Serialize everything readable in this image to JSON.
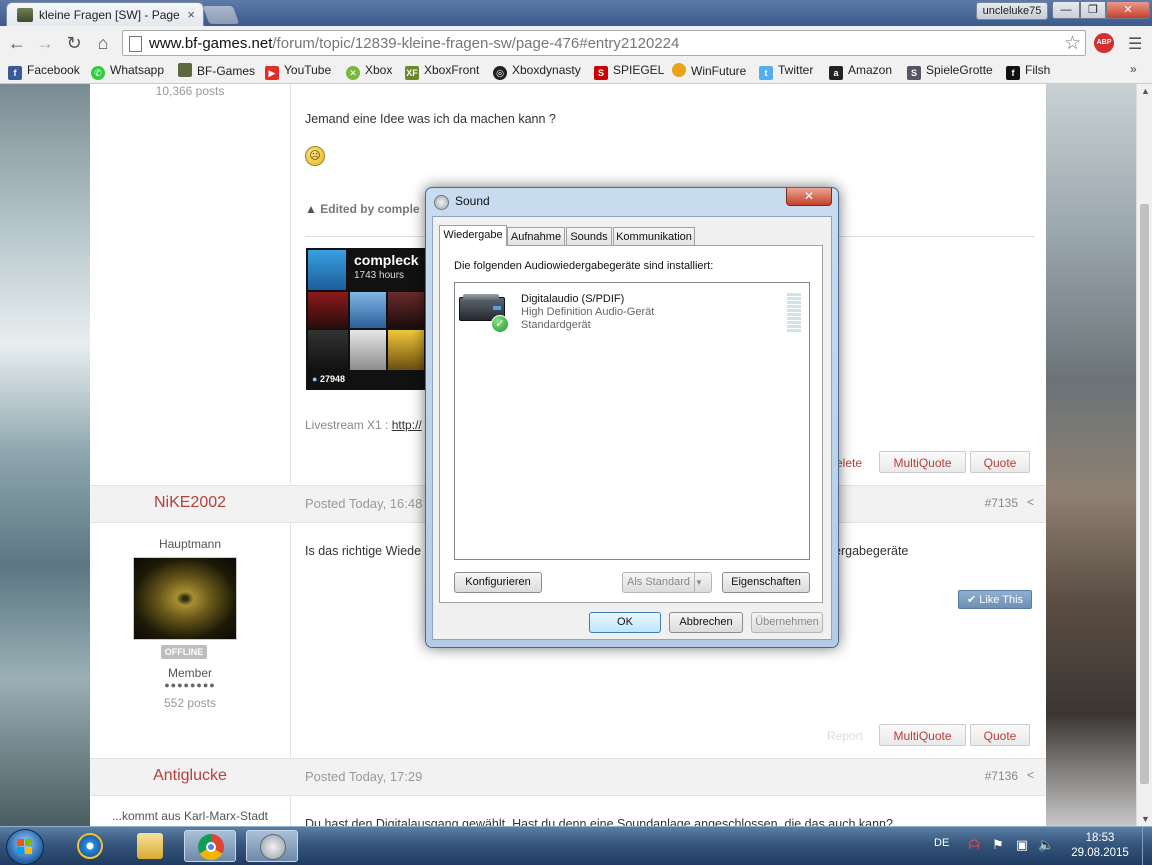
{
  "browser": {
    "tab_title": "kleine Fragen [SW] - Page",
    "user_name": "uncleluke75",
    "url_host": "www.bf-games.net",
    "url_path": "/forum/topic/12839-kleine-fragen-sw/page-476#entry2120224",
    "abp_label": "ABP",
    "bookmarks": [
      "Facebook",
      "Whatsapp",
      "BF-Games",
      "YouTube",
      "Xbox",
      "XboxFront",
      "Xboxdynasty",
      "SPIEGEL",
      "WinFuture",
      "Twitter",
      "Amazon",
      "SpieleGrotte",
      "Filsh"
    ]
  },
  "forum": {
    "prev_author_posts": "10,366 posts",
    "prev_text": "Jemand eine Idee was ich da machen kann ?",
    "edited_by": "Edited by comple",
    "sig_name": "compleck",
    "sig_hours": "1743 hours",
    "sig_score": "27948",
    "livestream_label": "Livestream X1 :",
    "livestream_link": "http://",
    "delete_label": "elete",
    "multiquote": "MultiQuote",
    "quote": "Quote",
    "report": "Report",
    "like": "Like This",
    "post2": {
      "author": "NiKE2002",
      "posted": "Posted Today, 16:48",
      "number": "#7135",
      "rank": "Hauptmann",
      "status": "OFFLINE",
      "group": "Member",
      "posts": "552 posts",
      "text_start": "Is das richtige Wiede",
      "text_end": "ergabegeräte"
    },
    "post3": {
      "author": "Antiglucke",
      "posted": "Posted Today, 17:29",
      "number": "#7136",
      "location": "...kommt aus Karl-Marx-Stadt",
      "text": "Du hast den Digitalausgang gewählt. Hast du denn eine Soundanlage angeschlossen, die das auch kann?"
    }
  },
  "dialog": {
    "title": "Sound",
    "tabs": [
      "Wiedergabe",
      "Aufnahme",
      "Sounds",
      "Kommunikation"
    ],
    "intro": "Die folgenden Audiowiedergabegeräte sind installiert:",
    "device": {
      "name": "Digitalaudio (S/PDIF)",
      "type": "High Definition Audio-Gerät",
      "status": "Standardgerät"
    },
    "buttons": {
      "configure": "Konfigurieren",
      "set_default": "Als Standard",
      "properties": "Eigenschaften",
      "ok": "OK",
      "cancel": "Abbrechen",
      "apply": "Übernehmen"
    }
  },
  "taskbar": {
    "language": "DE",
    "time": "18:53",
    "date": "29.08.2015"
  },
  "colors": {
    "forum_red": "#b5403c",
    "chrome_blue": "#3b5b8c",
    "taskbar": "#36567c"
  }
}
